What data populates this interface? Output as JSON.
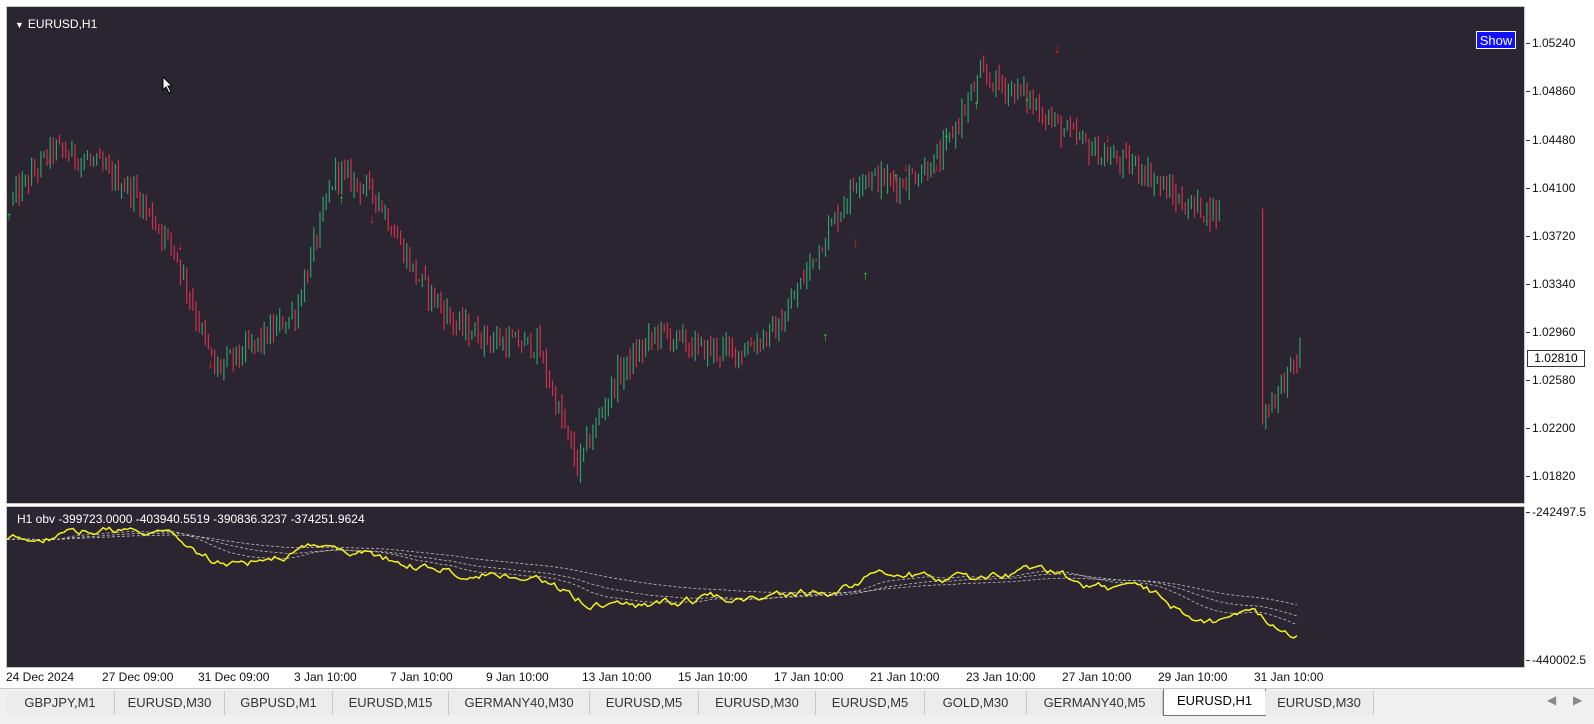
{
  "window": {
    "title": "EURUSD,H1"
  },
  "buttons": {
    "show": "Show"
  },
  "price_axis": {
    "ticks": [
      "1.05240",
      "1.04860",
      "1.04480",
      "1.04100",
      "1.03720",
      "1.03340",
      "1.02960",
      "1.02580",
      "1.02200",
      "1.01820"
    ],
    "current": "1.02810"
  },
  "obv_panel": {
    "label": "H1 obv  -399723.0000 -403940.5519 -390836.3237 -374251.9624",
    "scale_top": "-242497.5",
    "scale_bottom": "-440002.5",
    "line_color": "#f2f21c"
  },
  "time_axis": [
    "24 Dec 2024",
    "27 Dec 09:00",
    "31 Dec 09:00",
    "3 Jan 10:00",
    "7 Jan 10:00",
    "9 Jan 10:00",
    "13 Jan 10:00",
    "15 Jan 10:00",
    "17 Jan 10:00",
    "21 Jan 10:00",
    "23 Jan 10:00",
    "27 Jan 10:00",
    "29 Jan 10:00",
    "31 Jan 10:00"
  ],
  "tabs": [
    "GBPJPY,M1",
    "EURUSD,M30",
    "GBPUSD,M1",
    "EURUSD,M15",
    "GERMANY40,M30",
    "EURUSD,M5",
    "EURUSD,M30",
    "EURUSD,M5",
    "GOLD,M30",
    "GERMANY40,M5",
    "EURUSD,H1",
    "EURUSD,M30"
  ],
  "active_tab": 10,
  "colors": {
    "background": "#2a2530",
    "bull": "#2e9e6a",
    "bear": "#d0304a",
    "buy_signal": "#22cc33",
    "sell_signal": "#e8202a"
  },
  "chart_data": {
    "type": "candlestick",
    "title": "EURUSD,H1",
    "ylim": [
      1.0163,
      1.0543
    ],
    "price_path": [
      [
        "24 Dec 2024",
        1.0397
      ],
      [
        "27 Dec 09:00",
        1.0435
      ],
      [
        "28 Dec",
        1.0424
      ],
      [
        "30 Dec",
        1.0402
      ],
      [
        "31 Dec 09:00",
        1.0358
      ],
      [
        "1 Jan",
        1.0266
      ],
      [
        "2 Jan",
        1.0285
      ],
      [
        "3 Jan 10:00",
        1.031
      ],
      [
        "6 Jan",
        1.0418
      ],
      [
        "7 Jan 10:00",
        1.04
      ],
      [
        "8 Jan",
        1.0338
      ],
      [
        "9 Jan 10:00",
        1.03
      ],
      [
        "10 Jan",
        1.0288
      ],
      [
        "10 Jan b",
        1.0285
      ],
      [
        "13 Jan 10:00",
        1.0192
      ],
      [
        "14 Jan",
        1.0262
      ],
      [
        "15 Jan 10:00",
        1.0295
      ],
      [
        "16 Jan",
        1.0282
      ],
      [
        "17 Jan 10:00",
        1.028
      ],
      [
        "20 Jan",
        1.0298
      ],
      [
        "21 Jan",
        1.036
      ],
      [
        "21 Jan 10:00",
        1.0415
      ],
      [
        "22 Jan",
        1.0408
      ],
      [
        "23 Jan 10:00",
        1.0428
      ],
      [
        "24 Jan",
        1.049
      ],
      [
        "27 Jan",
        1.0478
      ],
      [
        "27 Jan 10:00",
        1.045
      ],
      [
        "28 Jan",
        1.043
      ],
      [
        "29 Jan 10:00",
        1.042
      ],
      [
        "30 Jan",
        1.0393
      ],
      [
        "30 Jan b",
        1.0385
      ],
      [
        "31 Jan 10:00",
        1.0232
      ],
      [
        "31 Jan b",
        1.0281
      ]
    ],
    "signals": [
      {
        "time": "24 Dec 2024",
        "type": "buy",
        "price": 1.038
      },
      {
        "time": "24 Dec 2024",
        "type": "sell",
        "price": 1.0398
      },
      {
        "time": "27 Dec 09:00",
        "type": "sell",
        "price": 1.0424
      },
      {
        "time": "31 Dec 09:00",
        "type": "sell",
        "price": 1.0358
      },
      {
        "time": "1 Jan",
        "type": "sell",
        "price": 1.0268
      },
      {
        "time": "6 Jan",
        "type": "buy",
        "price": 1.0393
      },
      {
        "time": "7 Jan 10:00",
        "type": "sell",
        "price": 1.0378
      },
      {
        "time": "21 Jan",
        "type": "buy",
        "price": 1.0288
      },
      {
        "time": "21 Jan 10:00",
        "type": "sell",
        "price": 1.036
      },
      {
        "time": "21 Jan 10:00",
        "type": "buy",
        "price": 1.0335
      },
      {
        "time": "22 Jan",
        "type": "buy",
        "price": 1.041
      },
      {
        "time": "22 Jan",
        "type": "sell",
        "price": 1.0418
      },
      {
        "time": "23 Jan 10:00",
        "type": "sell",
        "price": 1.0418
      },
      {
        "time": "23 Jan 10:00",
        "type": "buy",
        "price": 1.044
      },
      {
        "time": "24 Jan",
        "type": "buy",
        "price": 1.0465
      },
      {
        "time": "27 Jan",
        "type": "buy",
        "price": 1.0468
      },
      {
        "time": "27 Jan 10:00",
        "type": "sell",
        "price": 1.0508
      },
      {
        "time": "28 Jan",
        "type": "sell",
        "price": 1.044
      }
    ]
  }
}
